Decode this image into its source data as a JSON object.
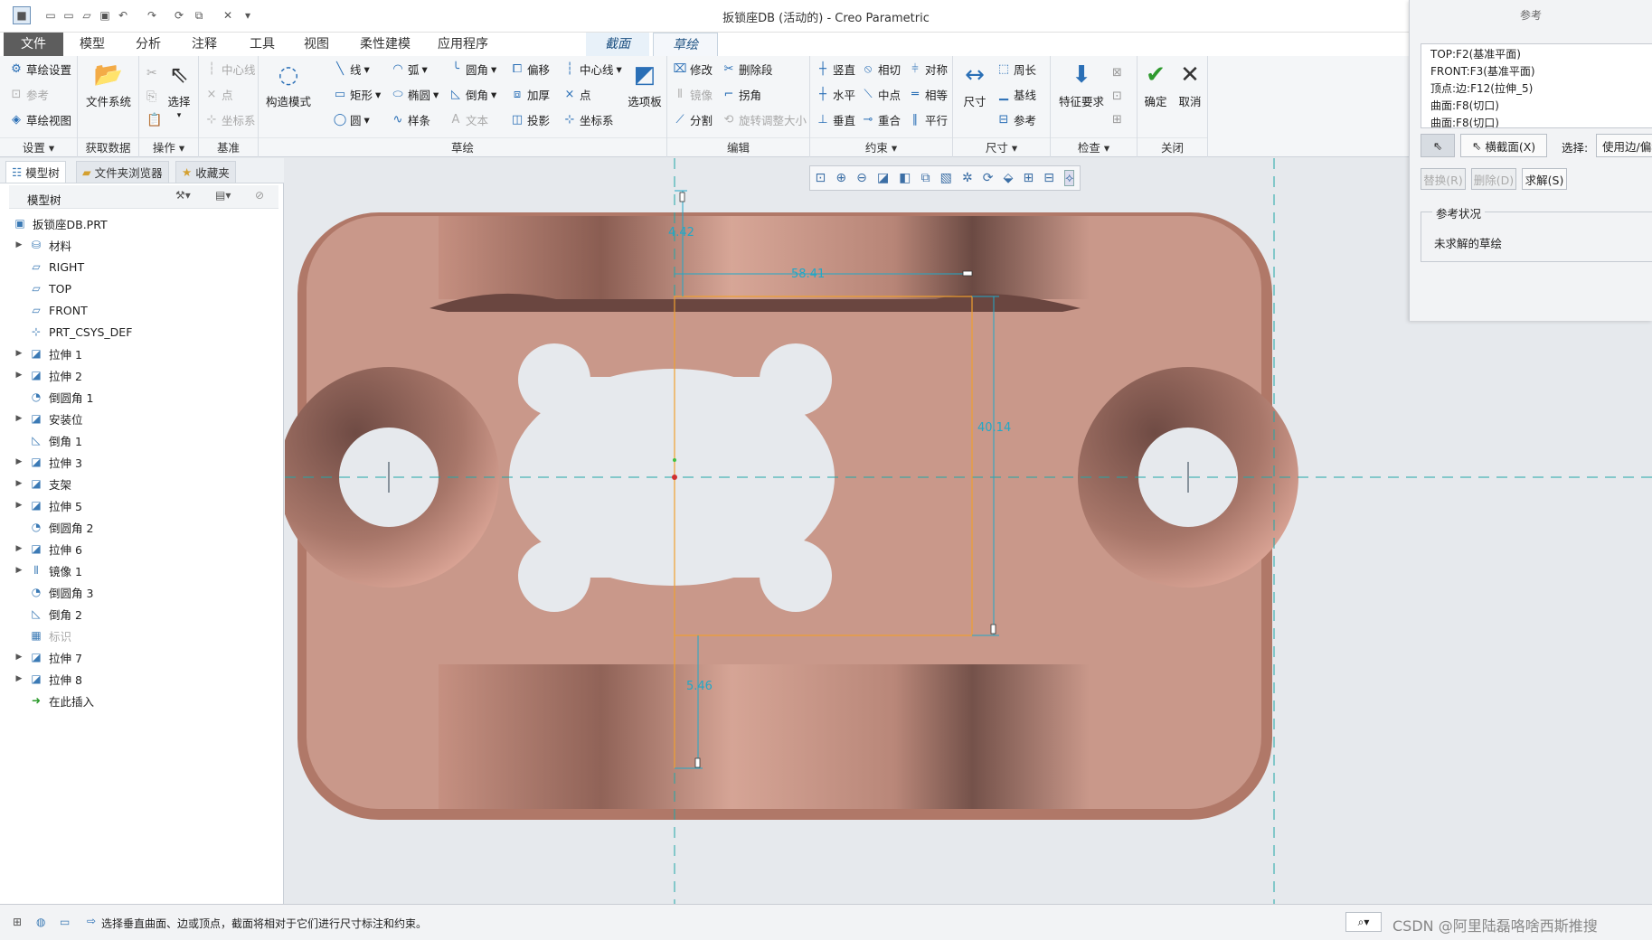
{
  "window": {
    "title": "扳锁座DB (活动的) - Creo Parametric"
  },
  "tabs": [
    {
      "label": "文件",
      "kind": "file"
    },
    {
      "label": "模型",
      "kind": "normal"
    },
    {
      "label": "分析",
      "kind": "normal"
    },
    {
      "label": "注释",
      "kind": "normal"
    },
    {
      "label": "工具",
      "kind": "normal"
    },
    {
      "label": "视图",
      "kind": "normal"
    },
    {
      "label": "柔性建模",
      "kind": "normal"
    },
    {
      "label": "应用程序",
      "kind": "normal"
    },
    {
      "label": "截面",
      "kind": "ctx"
    },
    {
      "label": "草绘",
      "kind": "active"
    }
  ],
  "ribbon": {
    "setup": {
      "label": "设置",
      "items": [
        "草绘设置",
        "参考",
        "草绘视图"
      ]
    },
    "getdata": {
      "label": "获取数据",
      "btn": "文件系统"
    },
    "ops": {
      "label": "操作",
      "select": "选择"
    },
    "datum": {
      "label": "基准",
      "items": [
        "中心线",
        "点",
        "坐标系"
      ]
    },
    "construct": "构造模式",
    "sketch": {
      "label": "草绘",
      "col1": [
        "线",
        "矩形",
        "圆"
      ],
      "col2": [
        "弧",
        "椭圆",
        "样条"
      ],
      "col3": [
        "圆角",
        "倒角",
        "文本"
      ],
      "col4": [
        "偏移",
        "加厚",
        "投影"
      ],
      "col5": [
        "中心线",
        "点",
        "坐标系"
      ],
      "palette": "选项板"
    },
    "edit": {
      "label": "编辑",
      "col1": [
        "修改",
        "镜像",
        "分割"
      ],
      "col2": [
        "删除段",
        "拐角",
        "旋转调整大小"
      ]
    },
    "constrain": {
      "label": "约束",
      "col1": [
        "竖直",
        "水平",
        "垂直"
      ],
      "col2": [
        "相切",
        "中点",
        "重合"
      ],
      "col3": [
        "对称",
        "相等",
        "平行"
      ]
    },
    "dimension": {
      "label": "尺寸",
      "btn": "尺寸",
      "items": [
        "周长",
        "基线",
        "参考"
      ]
    },
    "inspect": {
      "label": "检查",
      "btn": "特征要求"
    },
    "close": {
      "label": "关闭",
      "ok": "确定",
      "cancel": "取消"
    }
  },
  "left_panel": {
    "tabs": [
      "模型树",
      "文件夹浏览器",
      "收藏夹"
    ],
    "header": "模型树",
    "root": "扳锁座DB.PRT",
    "items": [
      {
        "label": "材料",
        "icon": "material-icon",
        "expand": true
      },
      {
        "label": "RIGHT",
        "icon": "datum-plane-icon",
        "expand": false
      },
      {
        "label": "TOP",
        "icon": "datum-plane-icon",
        "expand": false
      },
      {
        "label": "FRONT",
        "icon": "datum-plane-icon",
        "expand": false
      },
      {
        "label": "PRT_CSYS_DEF",
        "icon": "csys-icon",
        "expand": false
      },
      {
        "label": "拉伸 1",
        "icon": "extrude-icon",
        "expand": true
      },
      {
        "label": "拉伸 2",
        "icon": "extrude-icon",
        "expand": true
      },
      {
        "label": "倒圆角 1",
        "icon": "round-icon",
        "expand": false
      },
      {
        "label": "安装位",
        "icon": "extrude-icon",
        "expand": true
      },
      {
        "label": "倒角 1",
        "icon": "chamfer-icon",
        "expand": false
      },
      {
        "label": "拉伸 3",
        "icon": "extrude-icon",
        "expand": true
      },
      {
        "label": "支架",
        "icon": "extrude-icon",
        "expand": true
      },
      {
        "label": "拉伸 5",
        "icon": "extrude-icon",
        "expand": true
      },
      {
        "label": "倒圆角 2",
        "icon": "round-icon",
        "expand": false
      },
      {
        "label": "拉伸 6",
        "icon": "extrude-icon",
        "expand": true
      },
      {
        "label": "镜像 1",
        "icon": "mirror-icon",
        "expand": true
      },
      {
        "label": "倒圆角 3",
        "icon": "round-icon",
        "expand": false
      },
      {
        "label": "倒角 2",
        "icon": "chamfer-icon",
        "expand": false
      },
      {
        "label": "标识",
        "icon": "cosmetic-icon",
        "expand": false,
        "dim": true
      },
      {
        "label": "拉伸 7",
        "icon": "extrude-icon",
        "expand": true
      },
      {
        "label": "拉伸 8",
        "icon": "extrude-icon",
        "expand": true
      },
      {
        "label": "在此插入",
        "icon": "insert-arrow-icon",
        "expand": false
      }
    ]
  },
  "dims": {
    "d1": "4.42",
    "d2": "58.41",
    "d3": "40.14",
    "d4": "5.46"
  },
  "ref_panel": {
    "title": "参考",
    "refs": [
      "TOP:F2(基准平面)",
      "FRONT:F3(基准平面)",
      "顶点:边:F12(拉伸_5)",
      "曲面:F8(切口)",
      "曲面:F8(切口)"
    ],
    "xsec_btn": "横截面(X)",
    "select_label": "选择:",
    "select_value": "使用边/偏移",
    "replace": "替换(R)",
    "delete": "删除(D)",
    "solve": "求解(S)",
    "status_group": "参考状况",
    "status_text": "未求解的草绘"
  },
  "status": {
    "message": "选择垂直曲面、边或顶点，截面将相对于它们进行尺寸标注和约束。",
    "watermark": "CSDN @阿里陆磊咯啥西斯推搜"
  },
  "colors": {
    "part": "#c9988a",
    "accent": "#2a6fb6",
    "dim": "#20a8c8",
    "sketch": "#f0a030"
  }
}
